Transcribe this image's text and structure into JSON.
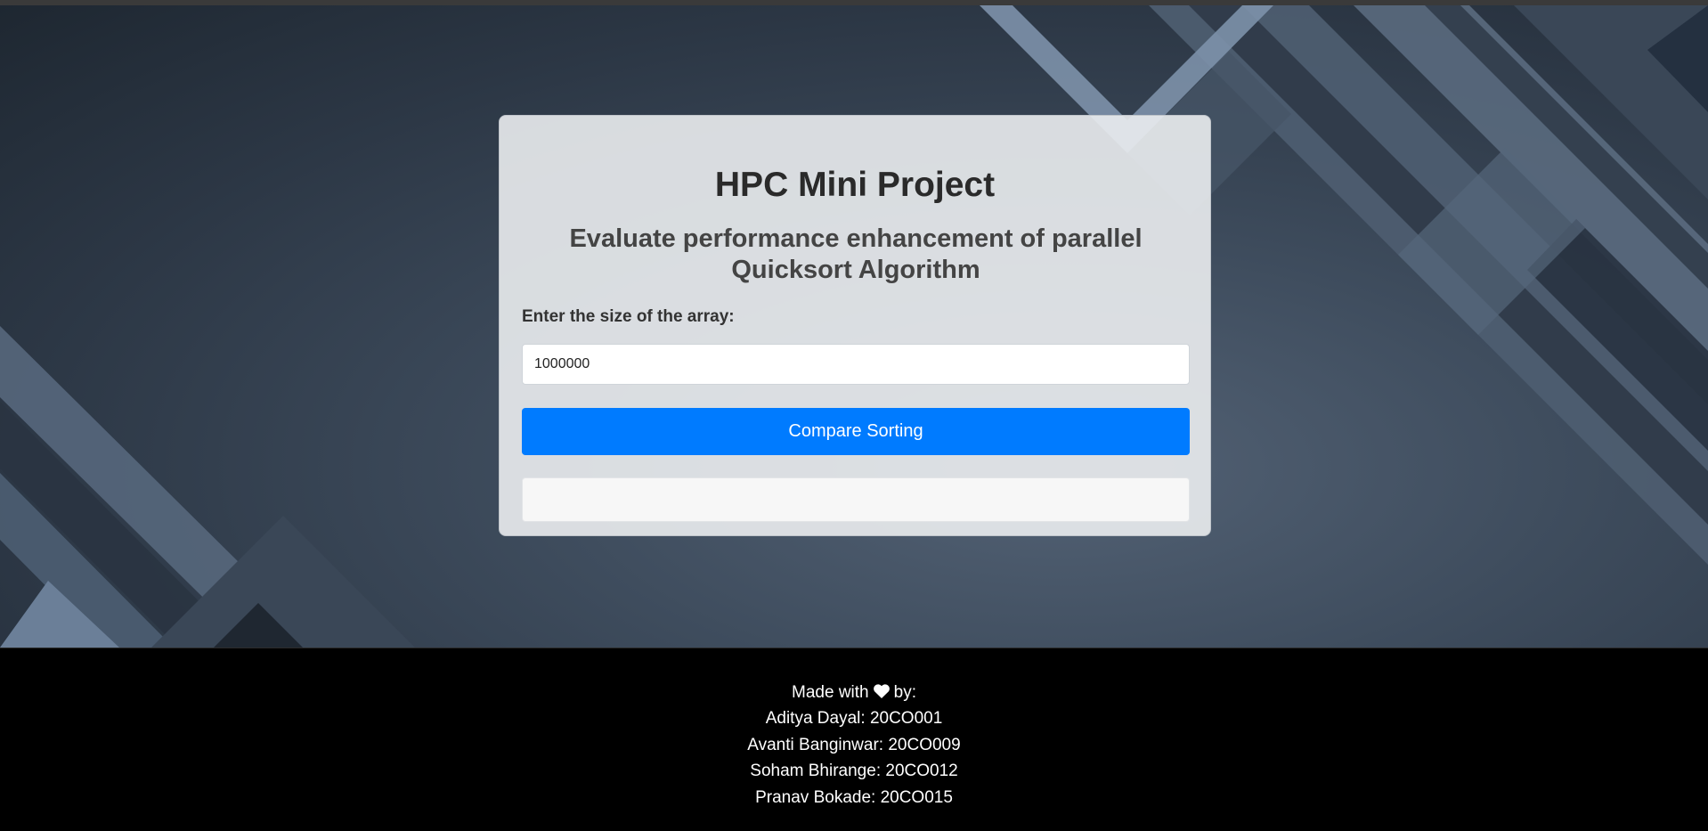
{
  "page": {
    "title": "HPC Mini Project",
    "subtitle": "Evaluate performance enhancement of parallel Quicksort Algorithm"
  },
  "form": {
    "label": "Enter the size of the array:",
    "input_value": "1000000",
    "button_label": "Compare Sorting",
    "result_text": ""
  },
  "footer": {
    "made_prefix": "Made with",
    "heart_icon": "heart-icon",
    "made_suffix": "by:",
    "members": [
      "Aditya Dayal: 20CO001",
      "Avanti Banginwar: 20CO009",
      "Soham Bhirange: 20CO012",
      "Pranav Bokade: 20CO015"
    ]
  },
  "colors": {
    "accent": "#007bff",
    "footer_bg": "#000000",
    "hero_bg": "#3e4c5d"
  }
}
